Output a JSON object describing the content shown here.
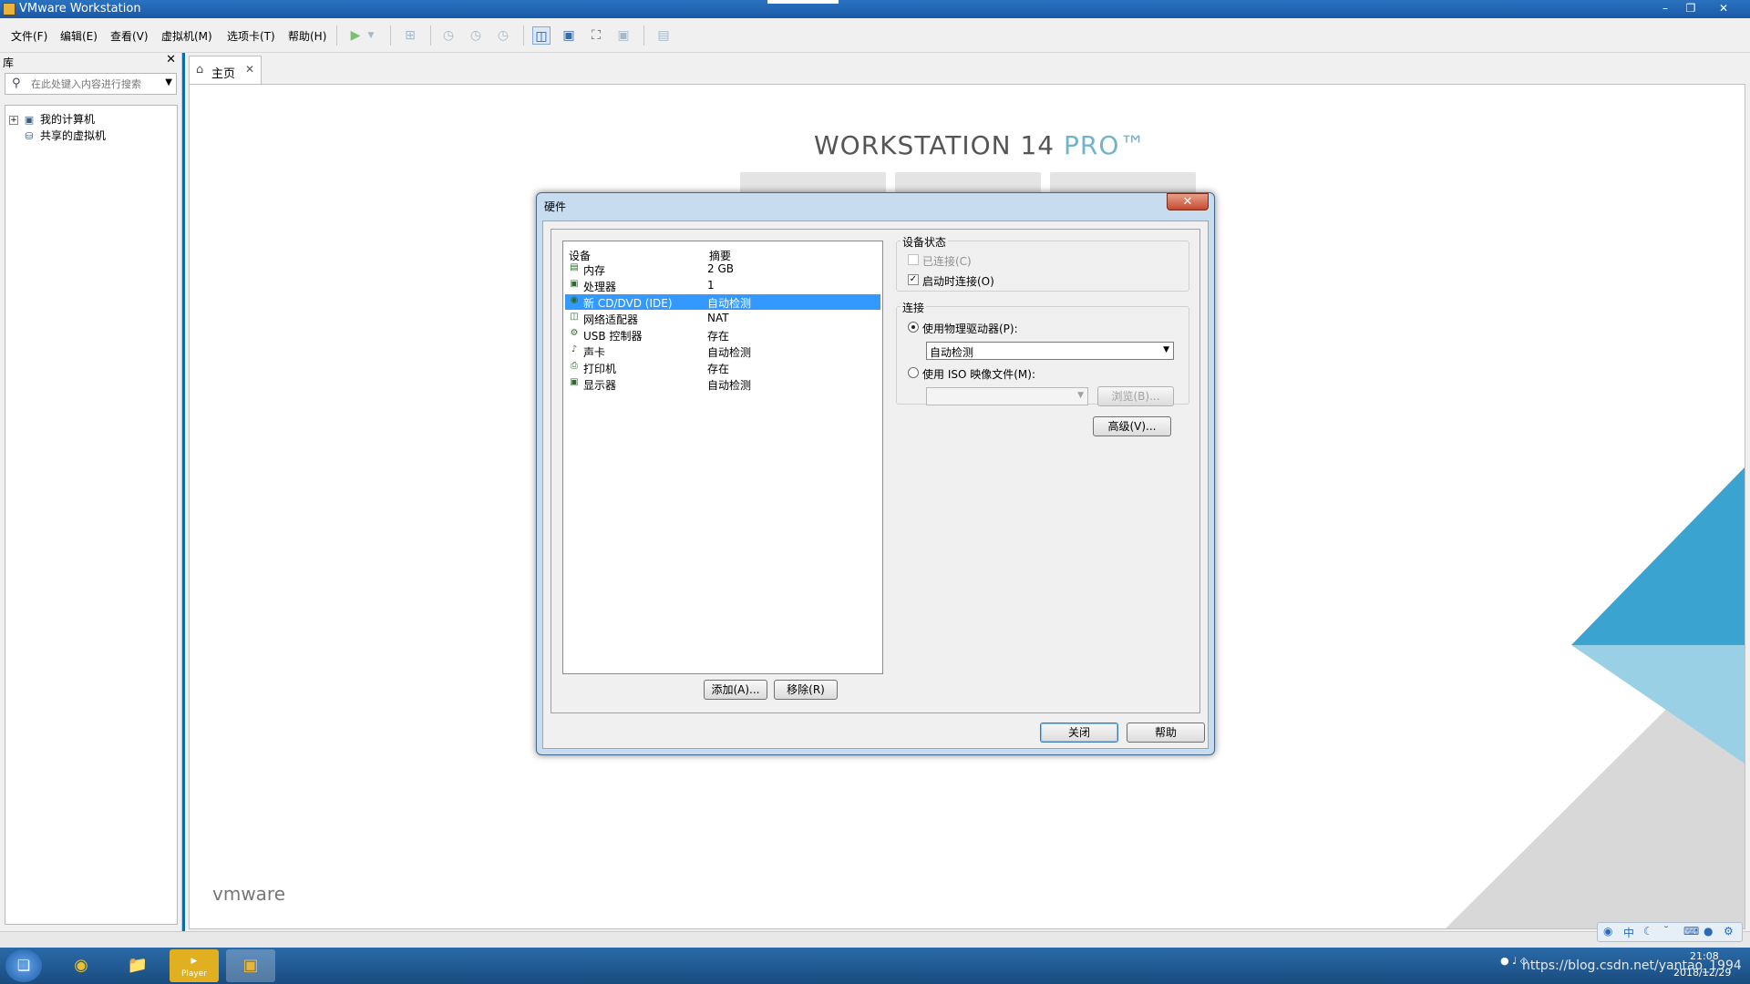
{
  "window": {
    "title": "VMware Workstation"
  },
  "menu": [
    "文件(F)",
    "编辑(E)",
    "查看(V)",
    "虚拟机(M)",
    "选项卡(T)",
    "帮助(H)"
  ],
  "library": {
    "header": "库",
    "search_placeholder": "在此处键入内容进行搜索",
    "tree": [
      "我的计算机",
      "共享的虚拟机"
    ]
  },
  "tabs": [
    {
      "label": "主页"
    }
  ],
  "home": {
    "title_main": "WORKSTATION 14 ",
    "title_pro": "PRO™",
    "logo": "vmware"
  },
  "dialog": {
    "title": "硬件",
    "columns": {
      "device": "设备",
      "summary": "摘要"
    },
    "devices": [
      {
        "name": "内存",
        "summary": "2 GB",
        "icon": "memory-icon"
      },
      {
        "name": "处理器",
        "summary": "1",
        "icon": "processor-icon"
      },
      {
        "name": "新 CD/DVD (IDE)",
        "summary": "自动检测",
        "icon": "cd-dvd-icon",
        "selected": true
      },
      {
        "name": "网络适配器",
        "summary": "NAT",
        "icon": "network-adapter-icon"
      },
      {
        "name": "USB 控制器",
        "summary": "存在",
        "icon": "usb-controller-icon"
      },
      {
        "name": "声卡",
        "summary": "自动检测",
        "icon": "sound-card-icon"
      },
      {
        "name": "打印机",
        "summary": "存在",
        "icon": "printer-icon"
      },
      {
        "name": "显示器",
        "summary": "自动检测",
        "icon": "display-icon"
      }
    ],
    "add_button": "添加(A)...",
    "remove_button": "移除(R)",
    "device_status": {
      "title": "设备状态",
      "connected": {
        "label": "已连接(C)",
        "checked": false,
        "enabled": false
      },
      "connect_at_power_on": {
        "label": "启动时连接(O)",
        "checked": true
      }
    },
    "connection": {
      "title": "连接",
      "physical": {
        "label": "使用物理驱动器(P):",
        "selected": true,
        "value": "自动检测"
      },
      "iso": {
        "label": "使用 ISO 映像文件(M):",
        "selected": false,
        "value": ""
      },
      "browse_button": "浏览(B)..."
    },
    "advanced_button": "高级(V)...",
    "close_button": "关闭",
    "help_button": "帮助"
  },
  "taskbar": {
    "apps": [
      "start-orb",
      "chrome",
      "explorer",
      "vmware-player",
      "vmware-workstation"
    ],
    "player_label": "Player",
    "time": "21:08",
    "date": "2018/12/29",
    "watermark": "https://blog.csdn.net/yantao_1994"
  },
  "ime": {
    "lang": "中"
  }
}
